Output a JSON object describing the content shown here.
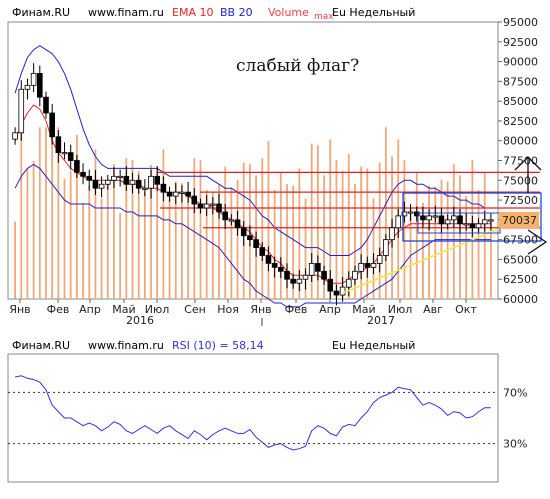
{
  "colors": {
    "background": "#ffffff",
    "plot_border": "#8a8a8a",
    "volume": "#f0a878",
    "ema": "#e8231e",
    "bollinger": "#2222cc",
    "candle_body_up": "#ffffff",
    "candle_body_down": "#000000",
    "hline": "#e02020",
    "trend": "#f2e64a",
    "rect_outer": "#2244dd",
    "rsi": "#3333dd",
    "label_box": "#f6b26b"
  },
  "main_header": {
    "source": "Финам.RU",
    "url": "www.finam.ru",
    "ema": "EMA 10",
    "bb": "BB 20",
    "volume": "Volume",
    "volume_max": "max",
    "instrument": "Eu Недельный"
  },
  "rsi_header": {
    "source": "Финам.RU",
    "url": "www.finam.ru",
    "rsi": "RSI (10) = 58,14",
    "instrument": "Eu Недельный"
  },
  "annotation": "слабый флаг?",
  "last_price_label": "70037",
  "chart_data": [
    {
      "type": "candlestick",
      "title": "",
      "y_ticks": [
        "95000",
        "92500",
        "90000",
        "87500",
        "85000",
        "82500",
        "80000",
        "77500",
        "75000",
        "72500",
        "70000",
        "67500",
        "65000",
        "62500",
        "60000"
      ],
      "ylim": [
        60000,
        95000
      ],
      "x_ticks": [
        "Янв",
        "Фев",
        "Апр",
        "Май",
        "Июл",
        "Сен",
        "Ноя",
        "Янв",
        "Фев",
        "Апр",
        "Май",
        "Июл",
        "Авг",
        "Окт"
      ],
      "year_labels": [
        "2016",
        "2017"
      ],
      "close": [
        81000,
        86500,
        87000,
        88500,
        85500,
        83500,
        80500,
        78500,
        78500,
        77500,
        76000,
        75500,
        75000,
        74000,
        74500,
        75000,
        75500,
        75500,
        74500,
        75000,
        74000,
        74000,
        75500,
        74500,
        73500,
        73000,
        73500,
        73500,
        73000,
        72000,
        71500,
        72000,
        72000,
        71000,
        70000,
        70000,
        69000,
        68000,
        67500,
        66500,
        65500,
        64500,
        64000,
        63500,
        62500,
        62000,
        62500,
        63000,
        64500,
        63500,
        62500,
        61000,
        60500,
        61500,
        62500,
        63500,
        64500,
        64000,
        64500,
        65500,
        67500,
        69000,
        70500,
        71000,
        71000,
        70500,
        70000,
        70500,
        70500,
        69500,
        70000,
        70500,
        69500,
        69500,
        69000,
        69500,
        70000,
        70000
      ],
      "volume_max": 87000,
      "resistance_levels": [
        76000,
        73500,
        71500,
        69000
      ],
      "ema_10": [
        80000,
        82000,
        83500,
        84500,
        84000,
        82500,
        80000,
        78500,
        77500,
        76500,
        76000,
        75500,
        75000,
        75000,
        75000,
        75000,
        75000,
        75000,
        74500,
        74500,
        74500,
        74000,
        74000,
        74000,
        73500,
        73500,
        73500,
        73500,
        73000,
        72500,
        72000,
        72000,
        71500,
        71000,
        70500,
        70000,
        69500,
        69000,
        68500,
        67500,
        66500,
        66000,
        65000,
        64500,
        63500,
        63000,
        63000,
        63000,
        63000,
        63000,
        62500,
        62000,
        62000,
        62000,
        62500,
        63000,
        63500,
        64000,
        64500,
        65500,
        66500,
        67500,
        68500,
        69000,
        69500,
        69500,
        69500,
        69500,
        69500,
        69500,
        69500,
        69500,
        69500,
        69500,
        69500,
        69500,
        69500,
        69500
      ],
      "bb_upper": [
        86000,
        88500,
        90500,
        91500,
        92000,
        91500,
        91000,
        90000,
        88500,
        86500,
        84000,
        81500,
        79500,
        78000,
        77000,
        76500,
        76500,
        76500,
        76500,
        76500,
        76500,
        76500,
        76500,
        76500,
        76000,
        75500,
        75500,
        75500,
        75500,
        75500,
        75500,
        75500,
        75000,
        74500,
        74000,
        74000,
        73500,
        73000,
        72500,
        71500,
        70500,
        70000,
        69000,
        68500,
        68000,
        67500,
        67000,
        66500,
        66500,
        66500,
        66000,
        65500,
        65500,
        65500,
        65500,
        66000,
        66500,
        67500,
        69000,
        70500,
        72000,
        73500,
        74500,
        75000,
        75000,
        74500,
        74500,
        74000,
        74000,
        73500,
        73000,
        73000,
        72500,
        72500,
        72000,
        72000,
        71500,
        71500
      ],
      "bb_lower": [
        74000,
        75500,
        76500,
        77000,
        76500,
        75500,
        74500,
        73500,
        72500,
        72000,
        72000,
        72000,
        72000,
        71500,
        71500,
        71500,
        71500,
        71500,
        71000,
        71000,
        70500,
        70500,
        70500,
        70500,
        70000,
        70000,
        69500,
        69500,
        69000,
        68500,
        68000,
        67500,
        67000,
        66500,
        65500,
        64500,
        63500,
        62500,
        62000,
        61000,
        60500,
        60000,
        59500,
        59500,
        59000,
        59000,
        59000,
        59500,
        59500,
        59500,
        59500,
        59500,
        59500,
        59500,
        59500,
        59500,
        60000,
        60500,
        61000,
        61500,
        62000,
        62500,
        63500,
        64500,
        65500,
        66000,
        66500,
        67000,
        67500,
        67500,
        67500,
        67500,
        67500,
        67500,
        67500,
        67500,
        67500,
        67500
      ]
    },
    {
      "type": "line",
      "title": "",
      "series": [
        {
          "values": [
            82,
            83,
            81,
            80,
            78,
            72,
            60,
            55,
            50,
            50,
            47,
            44,
            46,
            44,
            40,
            43,
            47,
            45,
            40,
            38,
            41,
            44,
            41,
            38,
            42,
            44,
            40,
            37,
            34,
            40,
            37,
            33,
            37,
            40,
            42,
            40,
            38,
            38,
            41,
            35,
            31,
            27,
            29,
            30,
            27,
            25,
            26,
            28,
            40,
            44,
            42,
            38,
            36,
            43,
            45,
            44,
            50,
            55,
            62,
            66,
            68,
            70,
            74,
            73,
            72,
            66,
            60,
            62,
            60,
            57,
            52,
            55,
            54,
            50,
            51,
            55,
            58,
            58
          ]
        }
      ],
      "ylim": [
        0,
        100
      ],
      "y_ticks": [
        "70%",
        "30%"
      ],
      "levels": [
        70,
        30
      ]
    }
  ]
}
